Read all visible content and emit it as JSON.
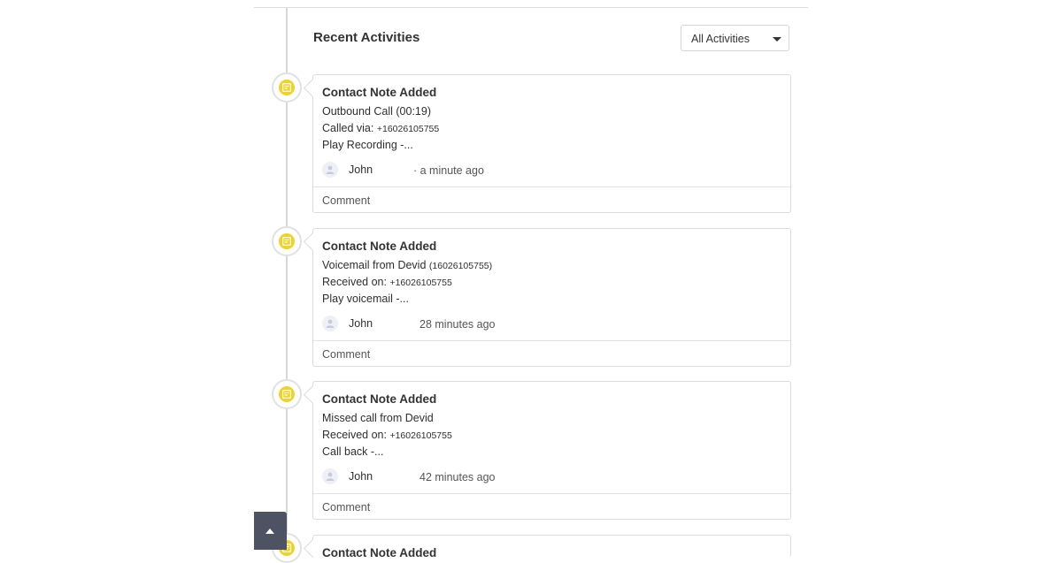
{
  "header": {
    "title": "Recent Activities",
    "filter": {
      "selected": "All Activities"
    }
  },
  "activities": [
    {
      "title": "Contact Note Added",
      "line1": "Outbound Call (00:19)",
      "line2_label": "Called via:",
      "line2_value": "+16026105755",
      "line3": "Play Recording -...",
      "user": "John",
      "time": "· a minute ago",
      "comment_label": "Comment",
      "icon": "note-icon"
    },
    {
      "title": "Contact Note Added",
      "line1": "Voicemail from Devid",
      "line1_extra": "(16026105755)",
      "line2_label": "Received on:",
      "line2_value": "+16026105755",
      "line3": "Play voicemail -...",
      "user": "John",
      "time": "28 minutes ago",
      "comment_label": "Comment",
      "icon": "note-icon"
    },
    {
      "title": "Contact Note Added",
      "line1": "Missed call from Devid",
      "line2_label": "Received on:",
      "line2_value": "+16026105755",
      "line3": "Call back -...",
      "user": "John",
      "time": "42 minutes ago",
      "comment_label": "Comment",
      "icon": "note-icon"
    },
    {
      "title": "Contact Note Added",
      "icon": "note-icon"
    }
  ],
  "colors": {
    "icon_accent": "#f0d32a",
    "scroll_button": "#4d5362"
  }
}
